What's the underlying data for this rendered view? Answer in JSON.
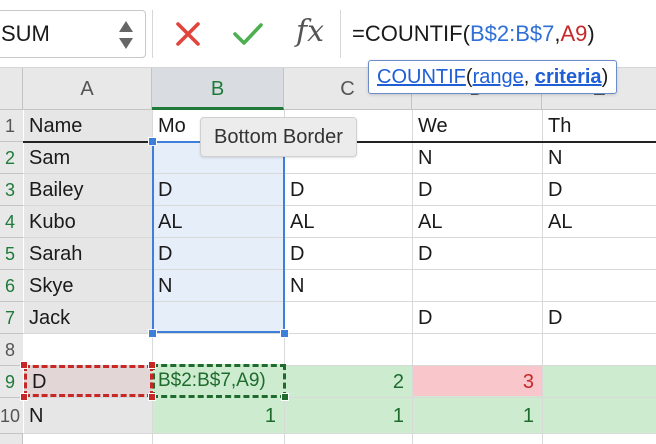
{
  "formula_bar": {
    "name_box": "SUM",
    "cancel_icon": "x-icon",
    "enter_icon": "checkmark-icon",
    "fx_label": "fx",
    "formula_prefix": "=COUNTIF(",
    "formula_ref_range": "B$2:B$7",
    "formula_comma": ",",
    "formula_ref_cell": "A9",
    "formula_suffix": ")"
  },
  "function_tooltip": {
    "name": "COUNTIF",
    "open": "(",
    "arg1": "range",
    "sep": ", ",
    "arg2": "criteria",
    "close": ")"
  },
  "hover_tooltip": "Bottom Border",
  "columns": [
    "A",
    "B",
    "C",
    "D",
    "E"
  ],
  "rows": [
    "1",
    "2",
    "3",
    "4",
    "5",
    "6",
    "7",
    "8",
    "9",
    "10"
  ],
  "sheet": {
    "header": {
      "a": "Name",
      "b": "Mo",
      "c": "",
      "d": "We",
      "e": "Th"
    },
    "data": [
      {
        "a": "Sam",
        "b": "",
        "c": "",
        "d": "N",
        "e": "N"
      },
      {
        "a": "Bailey",
        "b": "D",
        "c": "D",
        "d": "D",
        "e": "D"
      },
      {
        "a": "Kubo",
        "b": "AL",
        "c": "AL",
        "d": "AL",
        "e": "AL"
      },
      {
        "a": "Sarah",
        "b": "D",
        "c": "D",
        "d": "D",
        "e": ""
      },
      {
        "a": "Skye",
        "b": "N",
        "c": "N",
        "d": "",
        "e": ""
      },
      {
        "a": "Jack",
        "b": "",
        "c": "",
        "d": "D",
        "e": "D"
      }
    ],
    "row9": {
      "a": "D",
      "b_editing": "B$2:B$7,A9)",
      "c": "2",
      "d": "3"
    },
    "row10": {
      "a": "N",
      "b": "1",
      "c": "1",
      "d": "1"
    }
  },
  "colors": {
    "range_ref": "#2f6fd6",
    "cell_ref": "#c62828",
    "selection": "#3d7fd9",
    "count_green": "#1f6b2e",
    "count_highlight": "#f8c6cb"
  }
}
